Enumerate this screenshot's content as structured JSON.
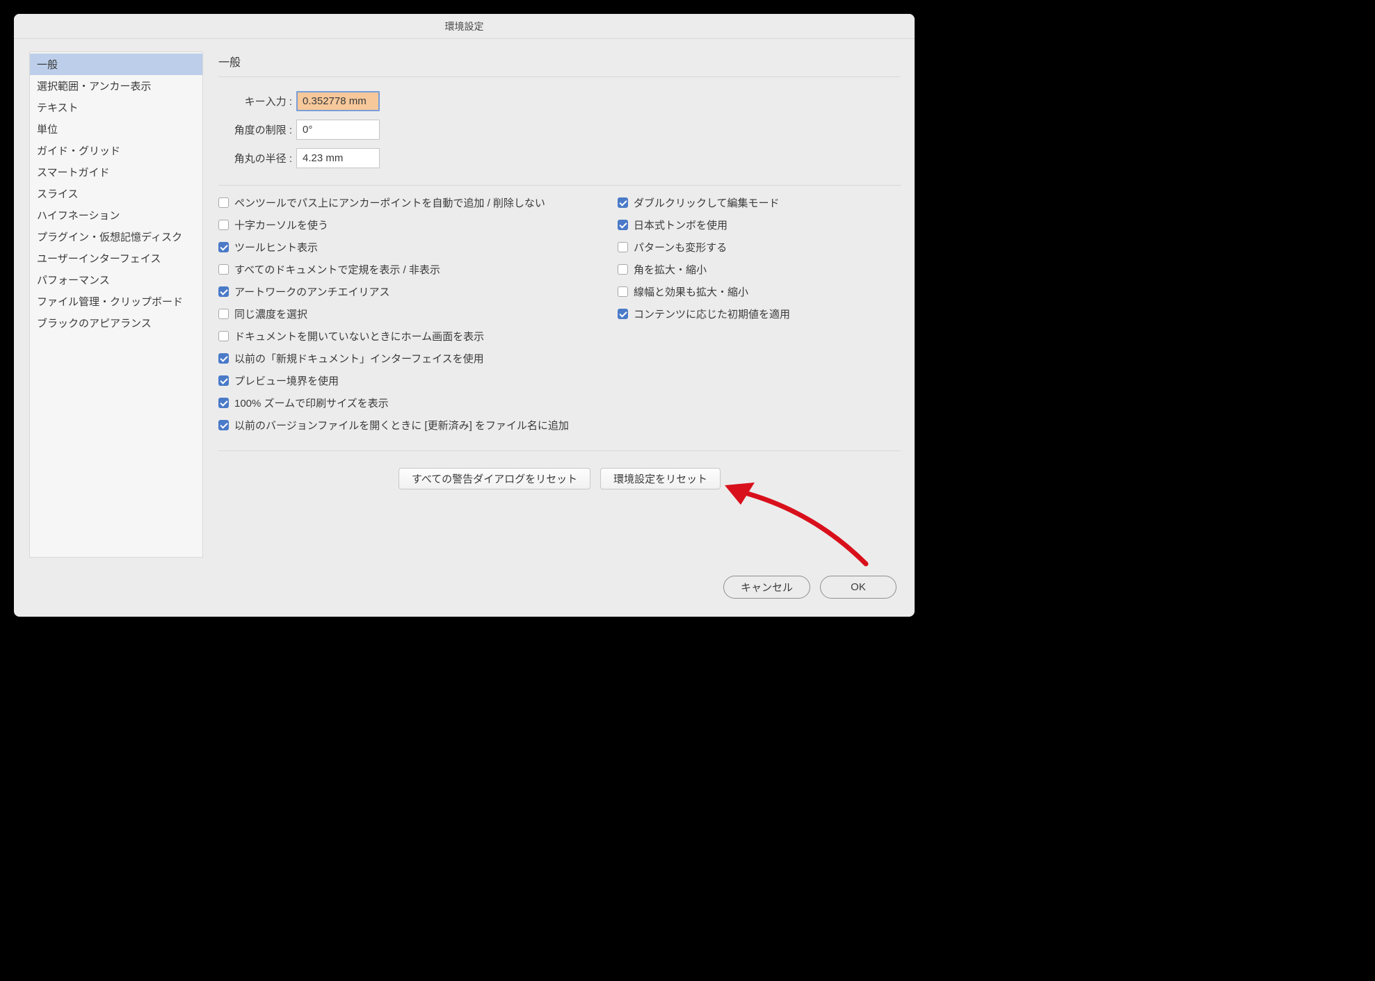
{
  "dialog": {
    "title": "環境設定"
  },
  "sidebar": {
    "items": [
      "一般",
      "選択範囲・アンカー表示",
      "テキスト",
      "単位",
      "ガイド・グリッド",
      "スマートガイド",
      "スライス",
      "ハイフネーション",
      "プラグイン・仮想記憶ディスク",
      "ユーザーインターフェイス",
      "パフォーマンス",
      "ファイル管理・クリップボード",
      "ブラックのアピアランス"
    ],
    "selected_index": 0
  },
  "main": {
    "heading": "一般",
    "fields": {
      "key_input": {
        "label": "キー入力 :",
        "value": "0.352778 mm"
      },
      "angle_limit": {
        "label": "角度の制限 :",
        "value": "0°"
      },
      "corner_radius": {
        "label": "角丸の半径 :",
        "value": "4.23 mm"
      }
    },
    "checkboxes_left": [
      {
        "label": "ペンツールでパス上にアンカーポイントを自動で追加 / 削除しない",
        "checked": false
      },
      {
        "label": "十字カーソルを使う",
        "checked": false
      },
      {
        "label": "ツールヒント表示",
        "checked": true
      },
      {
        "label": "すべてのドキュメントで定規を表示 / 非表示",
        "checked": false
      },
      {
        "label": "アートワークのアンチエイリアス",
        "checked": true
      },
      {
        "label": "同じ濃度を選択",
        "checked": false
      },
      {
        "label": "ドキュメントを開いていないときにホーム画面を表示",
        "checked": false
      },
      {
        "label": "以前の「新規ドキュメント」インターフェイスを使用",
        "checked": true
      },
      {
        "label": "プレビュー境界を使用",
        "checked": true
      },
      {
        "label": "100% ズームで印刷サイズを表示",
        "checked": true
      },
      {
        "label": "以前のバージョンファイルを開くときに [更新済み] をファイル名に追加",
        "checked": true
      }
    ],
    "checkboxes_right": [
      {
        "label": "ダブルクリックして編集モード",
        "checked": true
      },
      {
        "label": "日本式トンボを使用",
        "checked": true
      },
      {
        "label": "パターンも変形する",
        "checked": false
      },
      {
        "label": "角を拡大・縮小",
        "checked": false
      },
      {
        "label": "線幅と効果も拡大・縮小",
        "checked": false
      },
      {
        "label": "コンテンツに応じた初期値を適用",
        "checked": true
      }
    ],
    "reset_buttons": {
      "reset_warnings": "すべての警告ダイアログをリセット",
      "reset_prefs": "環境設定をリセット"
    }
  },
  "footer": {
    "cancel": "キャンセル",
    "ok": "OK"
  }
}
